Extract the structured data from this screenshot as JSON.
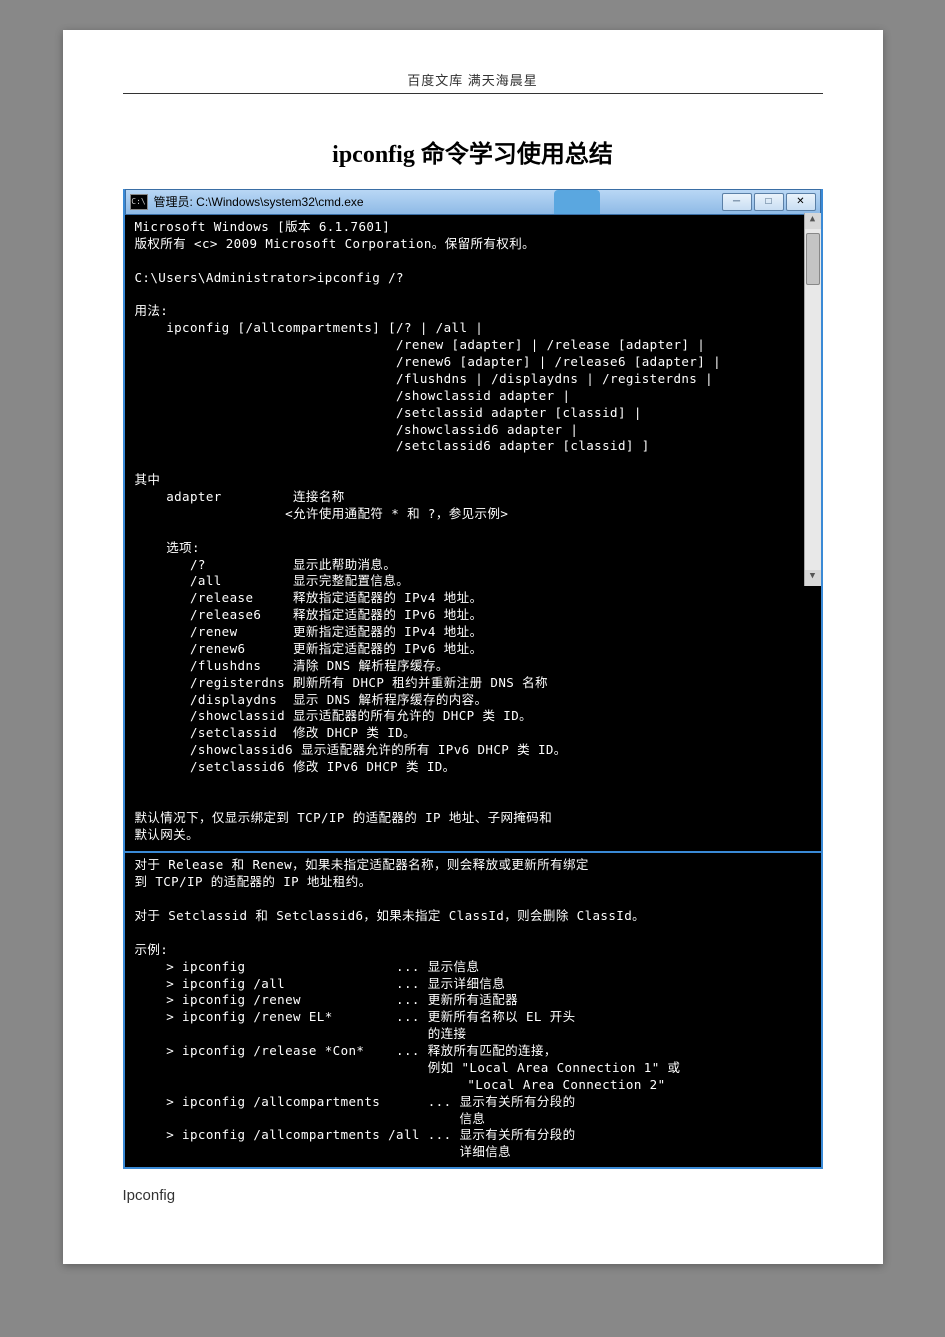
{
  "header": "百度文库 满天海晨星",
  "title": "ipconfig 命令学习使用总结",
  "window": {
    "caption": "管理员: C:\\Windows\\system32\\cmd.exe",
    "minimize": "─",
    "maximize": "□",
    "close": "✕",
    "icon_label": "C:\\"
  },
  "console_top": "Microsoft Windows [版本 6.1.7601]\n版权所有 <c> 2009 Microsoft Corporation。保留所有权利。\n\nC:\\Users\\Administrator>ipconfig /?\n\n用法:\n    ipconfig [/allcompartments] [/? | /all |\n                                 /renew [adapter] | /release [adapter] |\n                                 /renew6 [adapter] | /release6 [adapter] |\n                                 /flushdns | /displaydns | /registerdns |\n                                 /showclassid adapter |\n                                 /setclassid adapter [classid] |\n                                 /showclassid6 adapter |\n                                 /setclassid6 adapter [classid] ]\n\n其中\n    adapter         连接名称\n                   <允许使用通配符 * 和 ?，参见示例>\n\n    选项:\n       /?           显示此帮助消息。\n       /all         显示完整配置信息。\n       /release     释放指定适配器的 IPv4 地址。\n       /release6    释放指定适配器的 IPv6 地址。\n       /renew       更新指定适配器的 IPv4 地址。\n       /renew6      更新指定适配器的 IPv6 地址。\n       /flushdns    清除 DNS 解析程序缓存。\n       /registerdns 刷新所有 DHCP 租约并重新注册 DNS 名称\n       /displaydns  显示 DNS 解析程序缓存的内容。\n       /showclassid 显示适配器的所有允许的 DHCP 类 ID。\n       /setclassid  修改 DHCP 类 ID。\n       /showclassid6 显示适配器允许的所有 IPv6 DHCP 类 ID。\n       /setclassid6 修改 IPv6 DHCP 类 ID。\n\n\n默认情况下，仅显示绑定到 TCP/IP 的适配器的 IP 地址、子网掩码和\n默认网关。",
  "console_bottom": "对于 Release 和 Renew，如果未指定适配器名称，则会释放或更新所有绑定\n到 TCP/IP 的适配器的 IP 地址租约。\n\n对于 Setclassid 和 Setclassid6，如果未指定 ClassId，则会删除 ClassId。\n\n示例:\n    > ipconfig                   ... 显示信息\n    > ipconfig /all              ... 显示详细信息\n    > ipconfig /renew            ... 更新所有适配器\n    > ipconfig /renew EL*        ... 更新所有名称以 EL 开头\n                                     的连接\n    > ipconfig /release *Con*    ... 释放所有匹配的连接，\n                                     例如 \"Local Area Connection 1\" 或\n                                          \"Local Area Connection 2\"\n    > ipconfig /allcompartments      ... 显示有关所有分段的\n                                         信息\n    > ipconfig /allcompartments /all ... 显示有关所有分段的\n                                         详细信息",
  "footer_text": "Ipconfig"
}
